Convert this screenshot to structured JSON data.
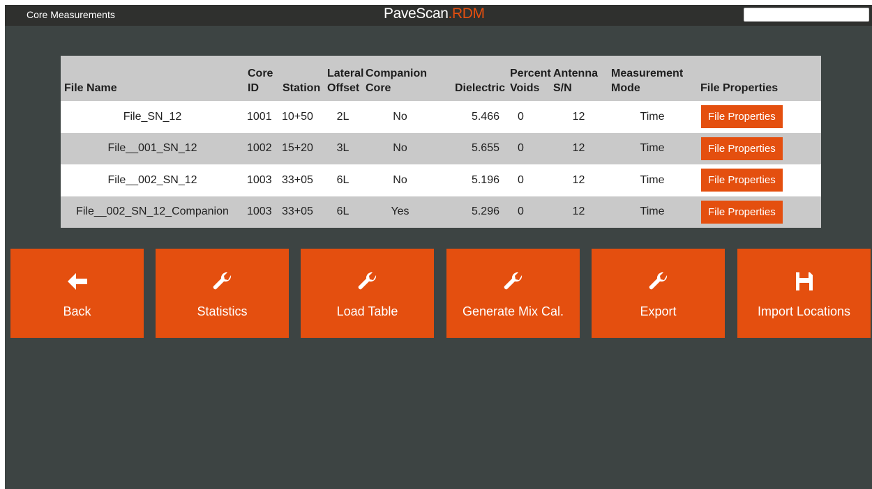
{
  "window": {
    "title": "Core Measurements",
    "brand_main": "PaveScan",
    "brand_accent": ".RDM",
    "input_value": ""
  },
  "colors": {
    "accent": "#e44f0f",
    "background": "#3d4443",
    "titlebar": "#2f302e",
    "row_alt": "#c9c9c9"
  },
  "table": {
    "headers": {
      "file_name": "File Name",
      "core_id_1": "Core",
      "core_id_2": "ID",
      "station": "Station",
      "lateral_1": "Lateral",
      "lateral_2": "Offset",
      "companion_1": "Companion",
      "companion_2": "Core",
      "dielectric": "Dielectric",
      "voids_1": "Percent",
      "voids_2": "Voids",
      "antenna_1": "Antenna",
      "antenna_2": "S/N",
      "mode_1": "Measurement",
      "mode_2": "Mode",
      "file_properties": "File Properties"
    },
    "rows": [
      {
        "file_name": "File_SN_12",
        "core_id": "1001",
        "station": "10+50",
        "lateral_offset": "2L",
        "companion": "No",
        "dielectric": "5.466",
        "percent_voids": "0",
        "antenna_sn": "12",
        "mode": "Time",
        "button": "File Properties"
      },
      {
        "file_name": "File__001_SN_12",
        "core_id": "1002",
        "station": "15+20",
        "lateral_offset": "3L",
        "companion": "No",
        "dielectric": "5.655",
        "percent_voids": "0",
        "antenna_sn": "12",
        "mode": "Time",
        "button": "File Properties"
      },
      {
        "file_name": "File__002_SN_12",
        "core_id": "1003",
        "station": "33+05",
        "lateral_offset": "6L",
        "companion": "No",
        "dielectric": "5.196",
        "percent_voids": "0",
        "antenna_sn": "12",
        "mode": "Time",
        "button": "File Properties"
      },
      {
        "file_name": "File__002_SN_12_Companion",
        "core_id": "1003",
        "station": "33+05",
        "lateral_offset": "6L",
        "companion": "Yes",
        "dielectric": "5.296",
        "percent_voids": "0",
        "antenna_sn": "12",
        "mode": "Time",
        "button": "File Properties"
      }
    ]
  },
  "actions": [
    {
      "label": "Back",
      "icon": "arrow-left-icon"
    },
    {
      "label": "Statistics",
      "icon": "wrench-icon"
    },
    {
      "label": "Load Table",
      "icon": "wrench-icon"
    },
    {
      "label": "Generate Mix Cal.",
      "icon": "wrench-icon"
    },
    {
      "label": "Export",
      "icon": "wrench-icon"
    },
    {
      "label": "Import Locations",
      "icon": "save-icon"
    }
  ]
}
